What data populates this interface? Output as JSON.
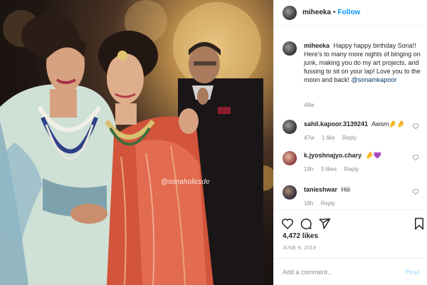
{
  "photo": {
    "watermark": "@sonaholicsde"
  },
  "header": {
    "username": "miheeka",
    "separator": "•",
    "follow_label": "Follow"
  },
  "caption": {
    "username": "miheeka",
    "text": "Happy happy birthday Sona!! Here's to many more nights of binging on junk, making you do my art projects, and fussing to sit on your lap! Love you to the moon and back!",
    "mention": "@sonamkapoor",
    "age": "48w"
  },
  "comments": [
    {
      "username": "sahil.kapoor.3139241",
      "text": "Awsm🤌🤌",
      "age": "47w",
      "likes": "1 like",
      "reply": "Reply"
    },
    {
      "username": "k.jyoshnajyo.chary",
      "text": "🤌💜",
      "age": "19h",
      "likes": "3 likes",
      "reply": "Reply"
    },
    {
      "username": "tanieshwar",
      "text": "Hiii",
      "age": "18h",
      "likes": "",
      "reply": "Reply"
    }
  ],
  "actions": {
    "icons": [
      "heart-icon",
      "comment-icon",
      "share-icon",
      "bookmark-icon"
    ]
  },
  "likes_count": "4,472 likes",
  "post_date": "JUNE 9, 2019",
  "add_comment": {
    "placeholder": "Add a comment...",
    "post_label": "Post"
  },
  "colors": {
    "accent": "#0095f6",
    "muted": "#8e8e8e",
    "text": "#262626",
    "post_disabled": "#b2dffc"
  }
}
